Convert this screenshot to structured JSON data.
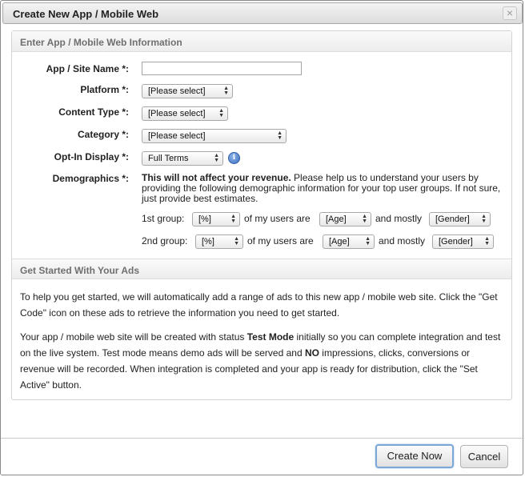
{
  "dialog": {
    "title": "Create New App / Mobile Web",
    "close_glyph": "×"
  },
  "info_section": {
    "heading": "Enter App / Mobile Web Information",
    "fields": {
      "app_name": {
        "label": "App / Site Name *:",
        "value": ""
      },
      "platform": {
        "label": "Platform *:",
        "selected": "[Please select]"
      },
      "content_type": {
        "label": "Content Type *:",
        "selected": "[Please select]"
      },
      "category": {
        "label": "Category *:",
        "selected": "[Please select]"
      },
      "optin_display": {
        "label": "Opt-In Display *:",
        "selected": "Full Terms",
        "info_icon": "info-icon"
      }
    },
    "demographics": {
      "label": "Demographics *:",
      "note_bold": "This will not affect your revenue.",
      "note_rest": " Please help us to understand your users by providing the following demographic information for your top user groups. If not sure, just provide best estimates.",
      "groups": [
        {
          "label": "1st group:",
          "percent": "[%]",
          "mid_text": "of my users are",
          "age": "[Age]",
          "and_text": "and mostly",
          "gender": "[Gender]"
        },
        {
          "label": "2nd group:",
          "percent": "[%]",
          "mid_text": "of my users are",
          "age": "[Age]",
          "and_text": "and mostly",
          "gender": "[Gender]"
        }
      ]
    }
  },
  "ads_section": {
    "heading": "Get Started With Your Ads",
    "para1": "To help you get started, we will automatically add a range of ads to this new app / mobile web site. Click the \"Get Code\" icon on these ads to retrieve the information you need to get started.",
    "para2_a": "Your app / mobile web site will be created with status ",
    "para2_b": "Test Mode",
    "para2_c": " initially so you can complete integration and test on the live system. Test mode means demo ads will be served and ",
    "para2_d": "NO",
    "para2_e": " impressions, clicks, conversions or revenue will be recorded. When integration is completed and your app is ready for distribution, click the \"Set Active\" button."
  },
  "footer": {
    "create_label": "Create Now",
    "cancel_label": "Cancel"
  }
}
